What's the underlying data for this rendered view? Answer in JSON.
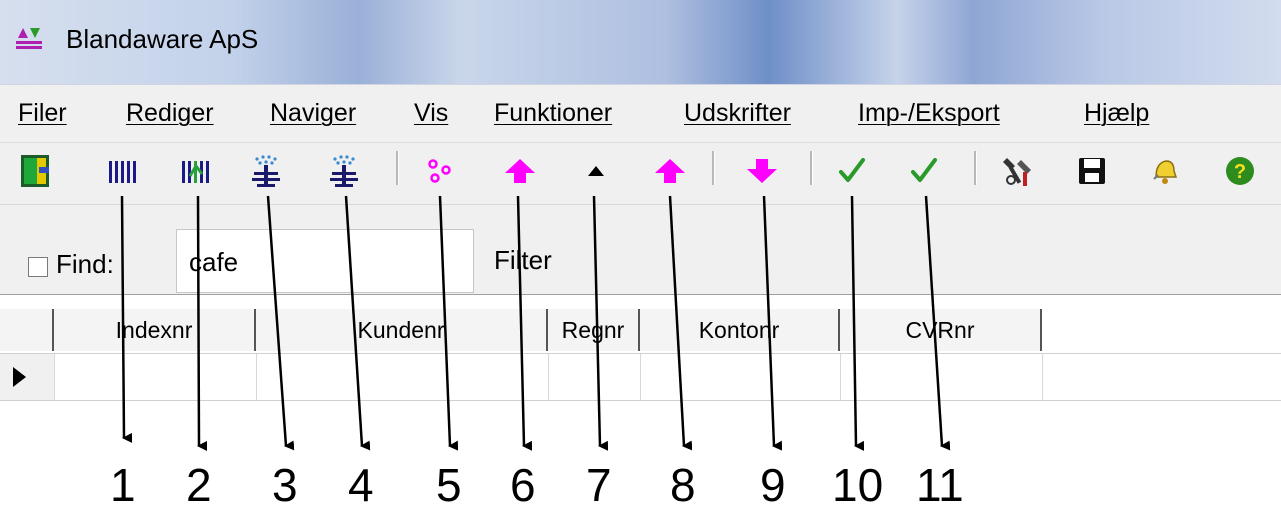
{
  "window": {
    "title": "Blandaware ApS",
    "icon": "app-arrows-icon"
  },
  "menu": [
    "Filer",
    "Rediger",
    "Naviger",
    "Vis",
    "Funktioner",
    "Udskrifter",
    "Imp-/Eksport",
    "Hjælp"
  ],
  "toolbar": {
    "buttons": [
      {
        "icon": "door-exit-icon"
      },
      {
        "icon": "barcode-icon"
      },
      {
        "icon": "barcode-green-icon"
      },
      {
        "icon": "fountain-icon"
      },
      {
        "icon": "fountain-icon"
      },
      {
        "icon": "pink-dots-icon"
      },
      {
        "icon": "arrow-up-magenta-icon"
      },
      {
        "icon": "arrow-up-black-small-icon"
      },
      {
        "icon": "arrow-up-magenta-icon"
      },
      {
        "icon": "arrow-down-magenta-icon"
      },
      {
        "icon": "checkmark-green-icon"
      },
      {
        "icon": "checkmark-green-icon"
      },
      {
        "icon": "tools-icon"
      },
      {
        "icon": "save-disk-icon"
      },
      {
        "icon": "bell-icon"
      },
      {
        "icon": "help-icon"
      }
    ]
  },
  "find": {
    "label": "Find:",
    "value": "cafe",
    "filter_label": "Filter"
  },
  "grid": {
    "columns": [
      "Indexnr",
      "Kundenr",
      "Regnr",
      "Kontonr",
      "CVRnr"
    ]
  },
  "annotations": [
    "1",
    "2",
    "3",
    "4",
    "5",
    "6",
    "7",
    "8",
    "9",
    "10",
    "11"
  ],
  "colors": {
    "accent_magenta": "#ff00ff",
    "check_green": "#2a9a2a",
    "help_green": "#2e8b1e"
  }
}
